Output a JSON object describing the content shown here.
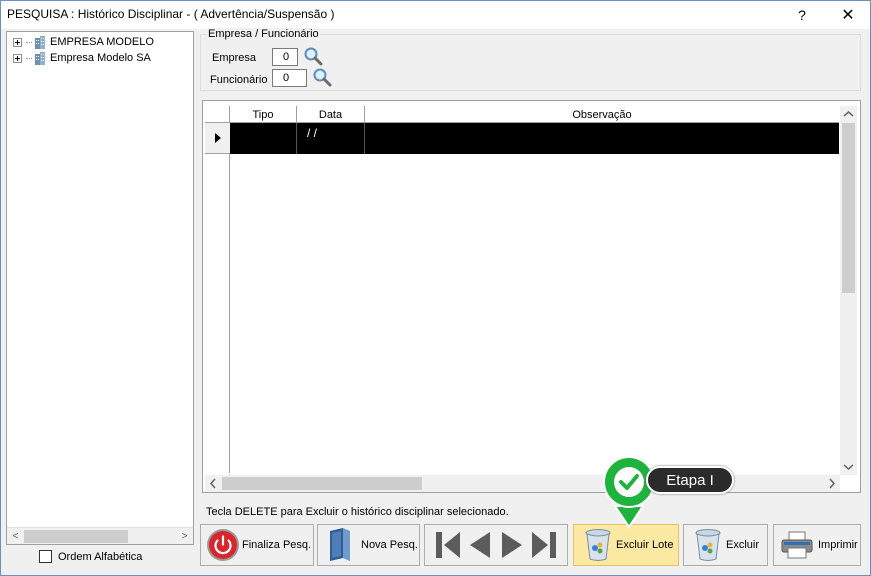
{
  "window": {
    "title": "PESQUISA : Histórico Disciplinar - ( Advertência/Suspensão )",
    "help": "?",
    "close": "✕"
  },
  "tree": {
    "items": [
      {
        "label": "EMPRESA MODELO"
      },
      {
        "label": "Empresa Modelo SA"
      }
    ],
    "scroll_left": "<",
    "scroll_right": ">"
  },
  "ordem": {
    "label": "Ordem Alfabética",
    "checked": false
  },
  "filter": {
    "group_title": "Empresa / Funcionário",
    "empresa_label": "Empresa",
    "empresa_value": "0",
    "funcionario_label": "Funcionário",
    "funcionario_value": "0"
  },
  "grid": {
    "columns": [
      "Tipo",
      "Data",
      "Observação"
    ],
    "rows": [
      {
        "tipo": "",
        "data": "/ /",
        "observacao": ""
      }
    ],
    "scroll_up": "^",
    "scroll_down": "v",
    "scroll_left": "<",
    "scroll_right": ">"
  },
  "hint": "Tecla DELETE para Excluir o histórico disciplinar selecionado.",
  "buttons": {
    "finaliza": "Finaliza Pesq.",
    "nova": "Nova Pesq.",
    "excluir_lote": "Excluir Lote",
    "excluir": "Excluir",
    "imprimir": "Imprimir"
  },
  "callout": {
    "label": "Etapa I"
  },
  "colors": {
    "accent": "#1db33c",
    "selected_row": "#000000",
    "active_button": "#fbe9a3",
    "power_red": "#d9262c"
  }
}
